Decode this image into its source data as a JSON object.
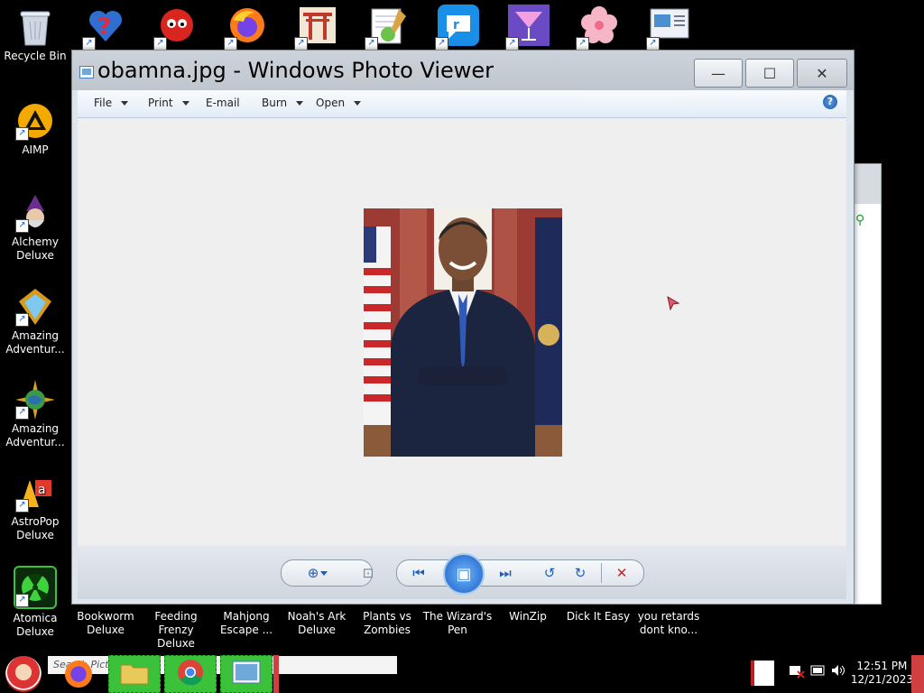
{
  "desktop": {
    "left_icons": [
      {
        "label": "Recycle Bin",
        "icon": "recycle-bin-icon"
      },
      {
        "label": "AIMP",
        "icon": "aimp-icon"
      },
      {
        "label": "Alchemy Deluxe",
        "icon": "alchemy-icon"
      },
      {
        "label": "Amazing Adventur...",
        "icon": "diamond-icon"
      },
      {
        "label": "Amazing Adventur...",
        "icon": "globe-icon"
      },
      {
        "label": "AstroPop Deluxe",
        "icon": "astropop-icon"
      },
      {
        "label": "Atomica Deluxe",
        "icon": "atomica-icon"
      }
    ],
    "top_icons": [
      "question-heart-icon",
      "red-puffball-icon",
      "firefox-icon",
      "torii-gate-icon",
      "notepad-frog-icon",
      "speech-bubble-icon",
      "cocktail-icon",
      "pink-flower-icon",
      "monitor-window-icon"
    ],
    "bottom_labels": [
      "Bookworm Deluxe",
      "Feeding Frenzy Deluxe",
      "Mahjong Escape ...",
      "Noah's Ark Deluxe",
      "Plants vs Zombies",
      "The Wizard's Pen",
      "WinZip",
      "Dick It Easy",
      "you retards dont kno..."
    ]
  },
  "window": {
    "title": "obamna.jpg - Windows Photo Viewer",
    "minimize": "—",
    "maximize": "☐",
    "close": "✕",
    "menu": [
      {
        "label": "File",
        "dropdown": true
      },
      {
        "label": "Print",
        "dropdown": true
      },
      {
        "label": "E-mail",
        "dropdown": false
      },
      {
        "label": "Burn",
        "dropdown": true
      },
      {
        "label": "Open",
        "dropdown": true
      }
    ],
    "help": "?",
    "controls": {
      "zoom": "⊕",
      "fit": "⊡",
      "previous": "⏮",
      "slideshow": "▣",
      "next": "⏭",
      "rotate_ccw": "↺",
      "rotate_cw": "↻",
      "delete": "✕"
    }
  },
  "taskbar": {
    "search_text": "Search Pictu",
    "time": "12:51 PM",
    "date": "12/21/2023"
  },
  "colors": {
    "desktop": "#000000",
    "window_frame": "#dfe5ec",
    "viewer_bg": "#efefef",
    "accent": "#1f5db8",
    "delete": "#d02020",
    "taskbar_highlight": "#3cc13a"
  }
}
